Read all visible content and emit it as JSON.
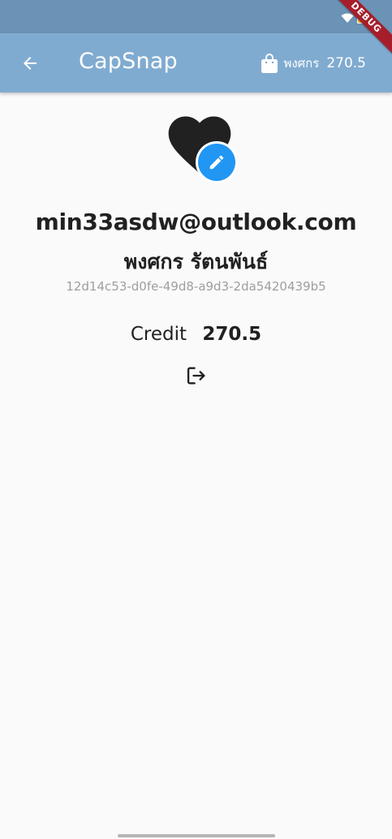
{
  "app_bar": {
    "title": "CapSnap",
    "user_label": "พงศกร",
    "credit": "270.5"
  },
  "status_bar": {
    "debug_label": "DEBUG"
  },
  "profile": {
    "email": "min33asdw@outlook.com",
    "name": "พงศกร รัตนพันธ์",
    "user_id": "12d14c53-d0fe-49d8-a9d3-2da5420439b5",
    "credit_label": "Credit",
    "credit_value": "270.5"
  },
  "colors": {
    "app_bar": "#80abd0",
    "status_bar": "#6b93b6",
    "accent": "#2196f3",
    "debug_banner": "#a51e2a"
  },
  "icons": {
    "back": "arrow-left-icon",
    "bag": "shopping-bag-icon",
    "avatar": "heart-icon",
    "edit": "pencil-icon",
    "logout": "logout-icon",
    "wifi": "wifi-icon",
    "battery": "battery-icon"
  }
}
